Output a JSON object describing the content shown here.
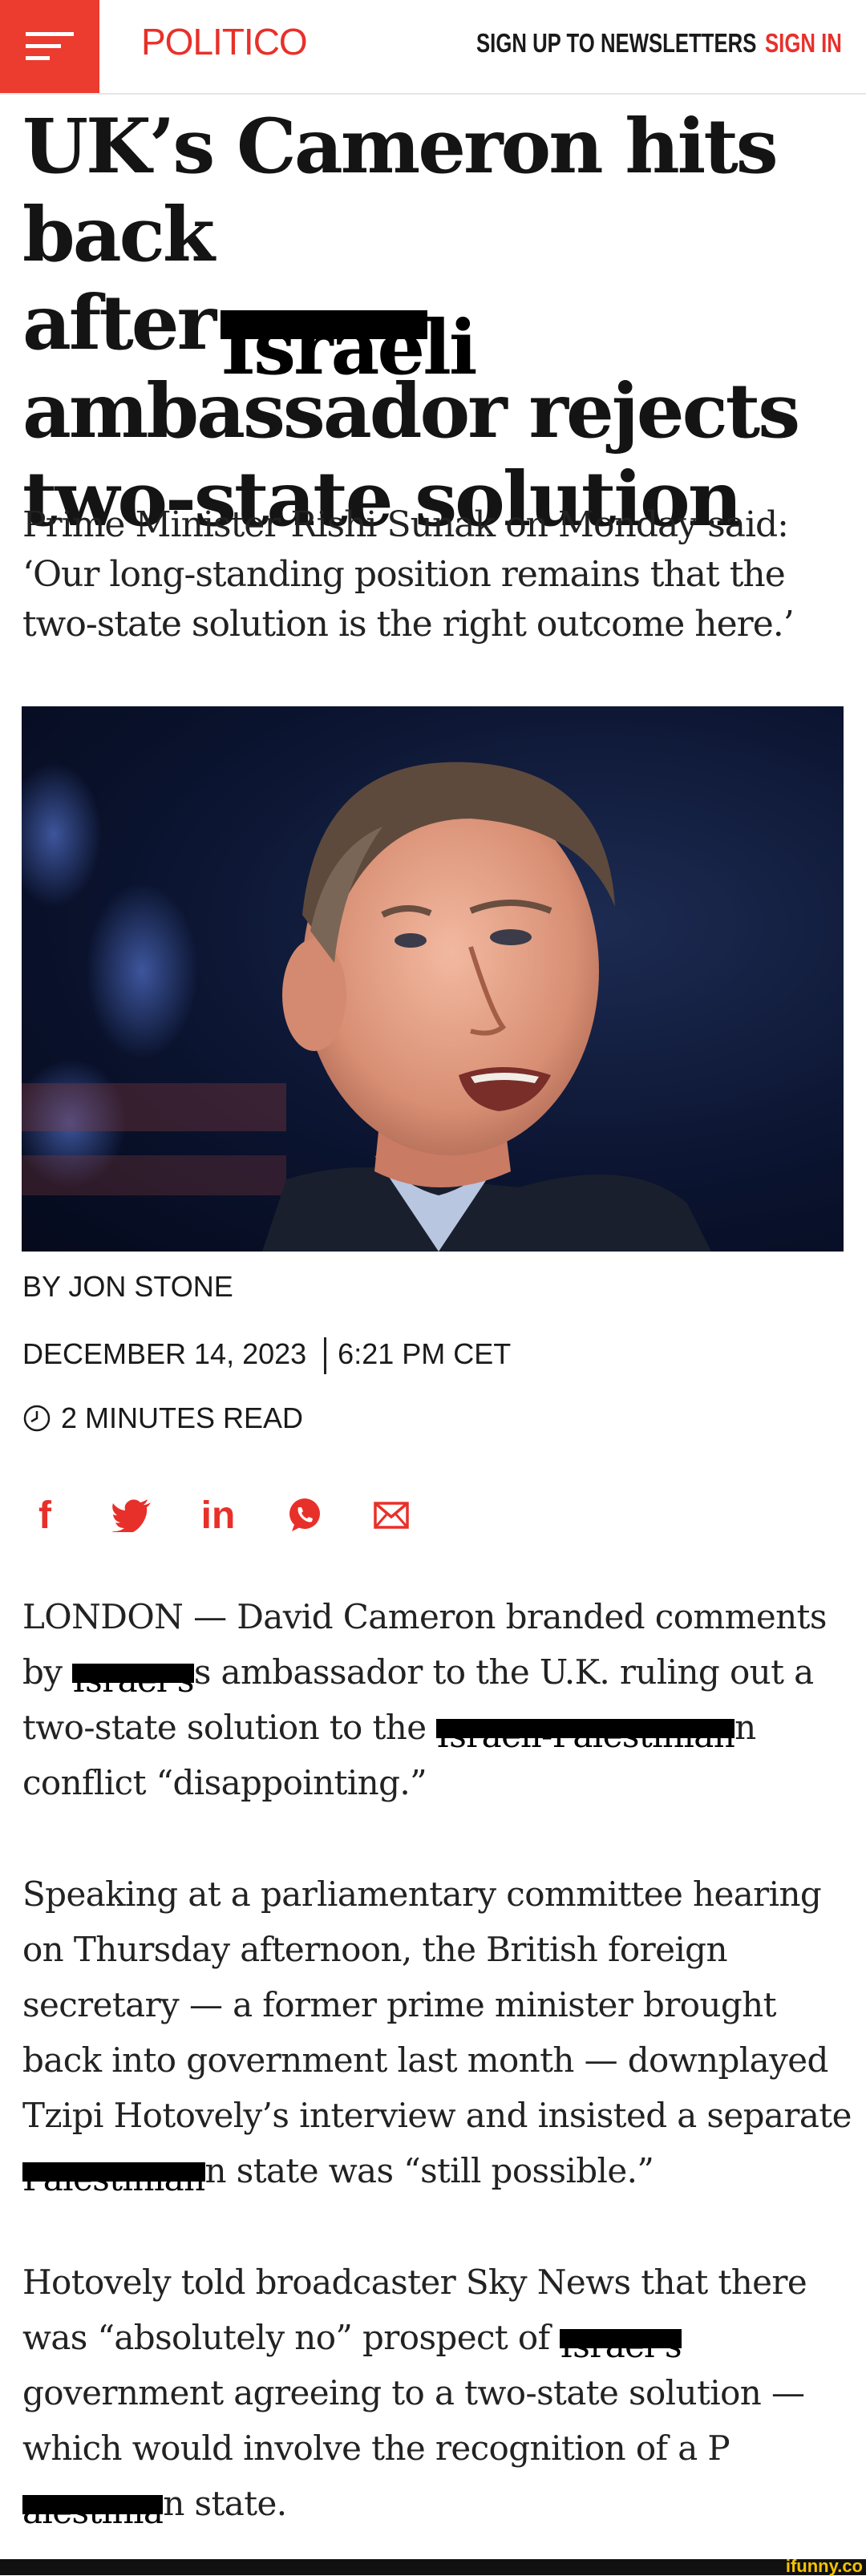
{
  "header": {
    "logo": "POLITICO",
    "newsletter_label": "SIGN UP TO NEWSLETTERS",
    "signin_label": "SIGN IN",
    "accent": "#ec3b2f"
  },
  "article": {
    "headline": {
      "line1": "UK’s Cameron hits back",
      "line2_before": "after",
      "line2_redacted": "Israeli",
      "line3": "ambassador rejects",
      "line4": "two-state solution"
    },
    "dek": "Prime Minister Rishi Sunak on Monday said: ‘Our long-standing position remains that the two-state solution is the right outcome here.’",
    "byline": "BY JON STONE",
    "date": "DECEMBER 14, 2023",
    "time": "6:21 PM CET",
    "read_time": "2 MINUTES READ",
    "share_icons": [
      "facebook-icon",
      "twitter-icon",
      "linkedin-icon",
      "whatsapp-icon",
      "email-icon"
    ],
    "paragraphs": {
      "p1": {
        "a": "LONDON — David Cameron branded comments by ",
        "r1": "Israel’s",
        "b": "s ambassador to the U.K. ruling out a two-state solution to the ",
        "r2": "Israeli-Palestinian",
        "c": "n conflict “disappointing.”"
      },
      "p2": {
        "a": "Speaking at a parliamentary committee hearing on Thursday afternoon, the British foreign secretary — a former prime minister brought back into government last month — downplayed Tzipi Hotovely’s interview and insisted a separate ",
        "r1": "Palestinian",
        "b": "n state was “still possible.”"
      },
      "p3": {
        "a": "Hotovely told broadcaster Sky News that there was “absolutely no” prospect of ",
        "r1": "Israel’s",
        "b": " government agreeing to a two-state solution — which would involve the recognition of a P",
        "r2": "alestinia",
        "c": "n state."
      }
    }
  },
  "watermark": "ifunny.co"
}
